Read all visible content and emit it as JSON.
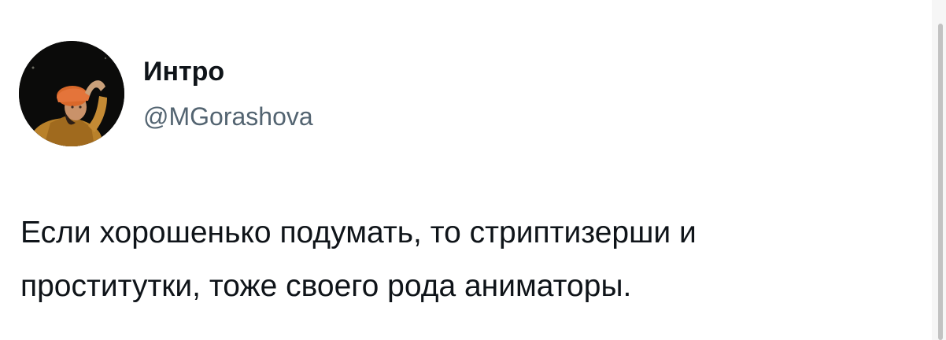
{
  "tweet": {
    "author": {
      "display_name": "Интро",
      "handle": "@MGorashova",
      "avatar_icon": "profile-photo"
    },
    "text_lines": [
      "Если хорошенько подумать, то стриптизерши и",
      "проститутки, тоже своего рода аниматоры."
    ]
  },
  "colors": {
    "primary_text": "#0f1419",
    "secondary_text": "#536471",
    "background": "#ffffff"
  }
}
